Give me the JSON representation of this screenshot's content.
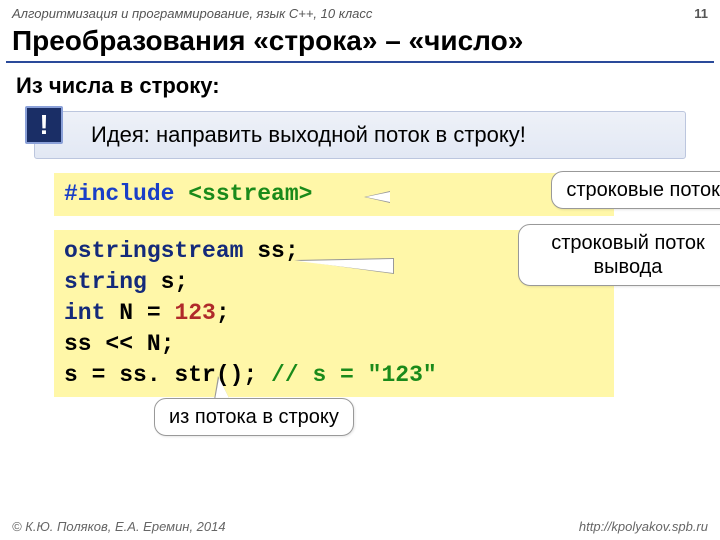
{
  "header": {
    "course": "Алгоритмизация и программирование, язык C++, 10 класс",
    "page": "11"
  },
  "title": "Преобразования «строка» – «число»",
  "subtitle": "Из числа в строку:",
  "idea": {
    "badge": "!",
    "text": "Идея: направить выходной поток в строку!"
  },
  "code1": {
    "include_kw": "#include",
    "include_hdr": "<sstream>",
    "callout": "строковые потоки"
  },
  "code2": {
    "l1a": "ostringstream",
    "l1b": " ss;",
    "l2a": "string",
    "l2b": " s;",
    "l3a": "int",
    "l3b": " N = ",
    "l3n": "123",
    "l3c": ";",
    "l4": "ss << N;",
    "l5a": "s = ss. str();    ",
    "l5c": "// s = \"123\"",
    "callout2": "строковый поток вывода",
    "callout3": "из потока в строку"
  },
  "footer": {
    "left": "© К.Ю. Поляков, Е.А. Еремин, 2014",
    "right": "http://kpolyakov.spb.ru"
  }
}
